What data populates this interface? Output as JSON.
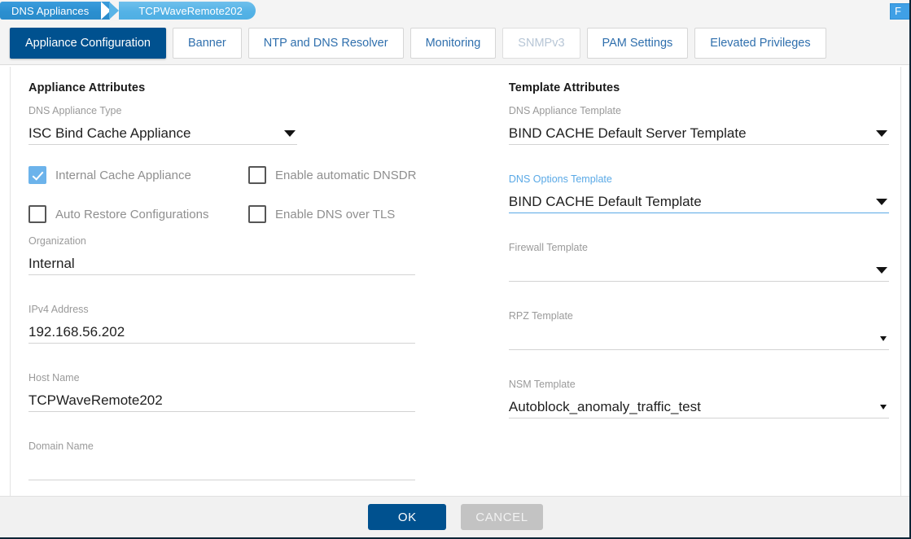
{
  "breadcrumb": {
    "items": [
      {
        "label": "DNS Appliances"
      },
      {
        "label": "TCPWaveRemote202"
      }
    ]
  },
  "corner_button": {
    "label": "F"
  },
  "tabs": [
    {
      "label": "Appliance Configuration",
      "state": "active"
    },
    {
      "label": "Banner",
      "state": "normal"
    },
    {
      "label": "NTP and DNS Resolver",
      "state": "normal"
    },
    {
      "label": "Monitoring",
      "state": "normal"
    },
    {
      "label": "SNMPv3",
      "state": "disabled"
    },
    {
      "label": "PAM Settings",
      "state": "normal"
    },
    {
      "label": "Elevated Privileges",
      "state": "normal"
    }
  ],
  "left": {
    "title": "Appliance Attributes",
    "appliance_type": {
      "label": "DNS Appliance Type",
      "value": "ISC Bind Cache Appliance"
    },
    "checkboxes": [
      {
        "label": "Internal Cache Appliance",
        "checked": true
      },
      {
        "label": "Enable automatic DNSDR",
        "checked": false
      },
      {
        "label": "Auto Restore Configurations",
        "checked": false
      },
      {
        "label": "Enable DNS over TLS",
        "checked": false
      }
    ],
    "organization": {
      "label": "Organization",
      "value": "Internal"
    },
    "ipv4_address": {
      "label": "IPv4 Address",
      "value": "192.168.56.202"
    },
    "host_name": {
      "label": "Host Name",
      "value": "TCPWaveRemote202"
    },
    "domain_name": {
      "label": "Domain Name",
      "value": ""
    }
  },
  "right": {
    "title": "Template Attributes",
    "dns_appliance_template": {
      "label": "DNS Appliance Template",
      "value": "BIND CACHE Default Server Template"
    },
    "dns_options_template": {
      "label": "DNS Options Template",
      "value": "BIND CACHE Default Template"
    },
    "firewall_template": {
      "label": "Firewall Template",
      "value": ""
    },
    "rpz_template": {
      "label": "RPZ Template",
      "value": ""
    },
    "nsm_template": {
      "label": "NSM Template",
      "value": "Autoblock_anomaly_traffic_test"
    }
  },
  "footer": {
    "ok_label": "OK",
    "cancel_label": "CANCEL"
  },
  "colors": {
    "active_tab": "#00518f",
    "tab_text": "#2f6fad",
    "focus_blue": "#5aa9e6",
    "checkbox_checked": "#6cb3eb",
    "crumb_primary": "#2b8fd0",
    "crumb_secondary": "#54b2e6"
  }
}
